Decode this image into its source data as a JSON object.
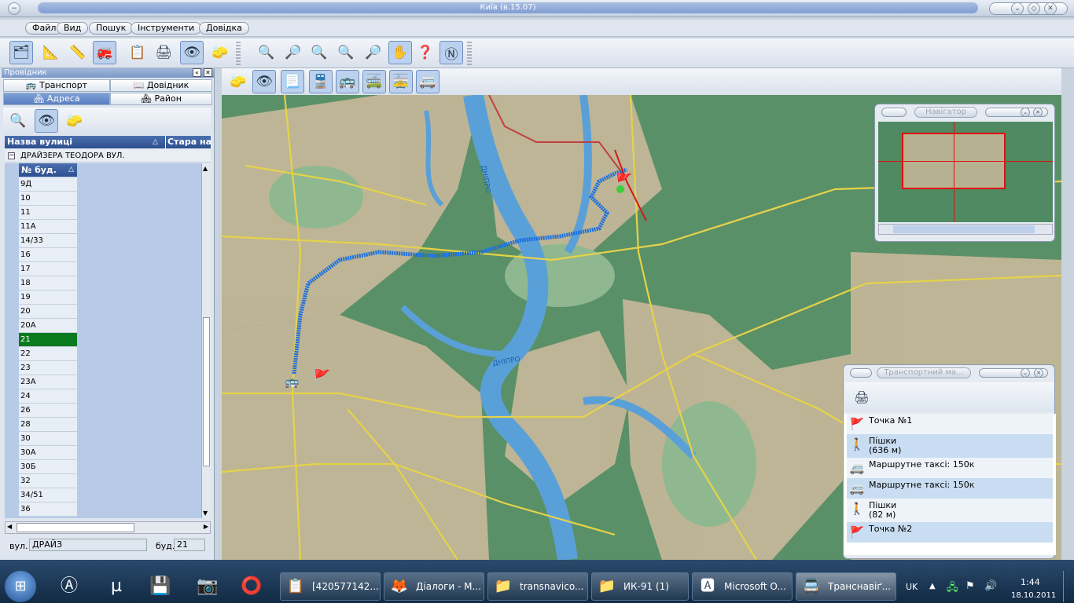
{
  "window": {
    "title": "Київ (в.15.07)"
  },
  "menu": [
    "Файл",
    "Вид",
    "Пошук",
    "Інструменти",
    "Довідка"
  ],
  "left_panel": {
    "title": "Провідник",
    "tabs": [
      {
        "label": "Транспорт",
        "icon": "bus-icon"
      },
      {
        "label": "Довідник",
        "icon": "book-icon"
      },
      {
        "label": "Адреса",
        "icon": "houses-icon"
      },
      {
        "label": "Район",
        "icon": "district-icon"
      }
    ],
    "col_street": "Назва вулиці",
    "col_old": "Стара наз",
    "street_name": "ДРАЙЗЕРА ТЕОДОРА ВУЛ.",
    "houses_header": "№ буд.",
    "houses": [
      "9Д",
      "10",
      "11",
      "11А",
      "14/33",
      "16",
      "17",
      "18",
      "19",
      "20",
      "20А",
      "21",
      "22",
      "23",
      "23А",
      "24",
      "26",
      "28",
      "30",
      "30А",
      "30Б",
      "32",
      "34/51",
      "36"
    ],
    "selected_house": "21",
    "street_label": "вул.",
    "street_value": "ДРАЙЗ",
    "house_label": "буд.",
    "house_value": "21"
  },
  "navigator": {
    "title": "Навігатор"
  },
  "transport": {
    "title": "Транспортний ма...",
    "items": [
      {
        "line1": "Точка №1",
        "line2": "",
        "icon": "red-flag-icon"
      },
      {
        "line1": "Пішки",
        "line2": "(636 м)",
        "icon": "walk-icon"
      },
      {
        "line1": "Маршрутне таксі: 150к",
        "line2": "",
        "icon": "taxi-in-icon"
      },
      {
        "line1": "Маршрутне таксі: 150к",
        "line2": "",
        "icon": "taxi-out-icon"
      },
      {
        "line1": "Пішки",
        "line2": "(82 м)",
        "icon": "walk-icon"
      },
      {
        "line1": "Точка №2",
        "line2": "",
        "icon": "red-flag-icon"
      }
    ]
  },
  "map_labels": [
    "ДНІПРО",
    "ДНІПРО"
  ],
  "taskbar": {
    "buttons": [
      "[420577142...",
      "Діалоги - М...",
      "transnavico...",
      "ИК-91 (1)",
      "Microsoft O...",
      "Транснавіґ..."
    ],
    "lang": "UK",
    "time": "1:44",
    "date": "18.10.2011"
  },
  "colors": {
    "selected_row": "#0b7a1e",
    "route": "#1a6fe0",
    "water": "#5aa0d8"
  }
}
